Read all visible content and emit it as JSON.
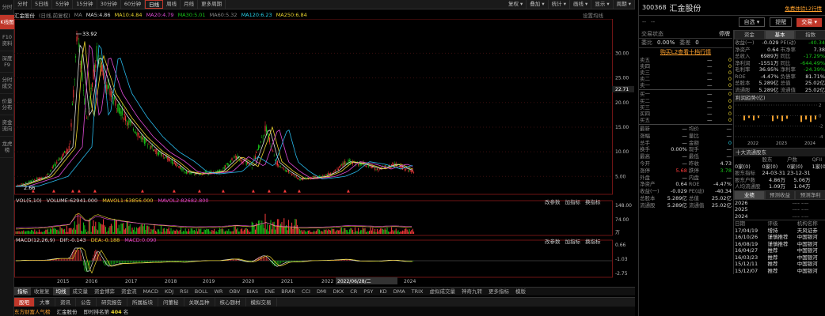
{
  "sidebar": {
    "items": [
      "分时",
      "K线图",
      "F10资料",
      "深度F9",
      "分时成交",
      "价量分布",
      "资金流向",
      "龙虎榜"
    ],
    "active": 1
  },
  "toolbar": {
    "left": [
      "分时",
      "5日线",
      "5分钟",
      "15分钟",
      "30分钟",
      "60分钟",
      "日线",
      "周线",
      "月线",
      "更多周期"
    ],
    "active": "日线",
    "right": [
      "复权",
      "叠加",
      "统计",
      "画线",
      "显示",
      "周期"
    ]
  },
  "indicators_line": {
    "name": "汇金股份",
    "mode": "(日线,前复权)",
    "ma_label": "MA",
    "ma5": "MA5:4.86",
    "ma10": "MA10:4.84",
    "ma20": "MA20:4.79",
    "ma30": "MA30:5.01",
    "ma60": "MA60:5.32",
    "ma120": "MA120:6.23",
    "ma250": "MA250:6.84",
    "settings": "设置均线"
  },
  "kline": {
    "high_marker": "33.92",
    "low_marker": "2.66",
    "y_ticks": [
      "30.00",
      "25.00",
      "20.00",
      "15.00",
      "10.00",
      "5.00"
    ],
    "current_price": "22.71"
  },
  "vol_pane": {
    "label": "VOL(5,10)",
    "volume": "VOLUME:62941.000",
    "mavol1": "MAVOL1:63856.000",
    "mavol2": "MAVOL2:82682.800",
    "actions": [
      "改参数",
      "加指标",
      "换指标"
    ],
    "y_ticks": [
      "148.00",
      "74.00"
    ],
    "unit": "万"
  },
  "macd_pane": {
    "label": "MACD(12,26,9)",
    "dif": "DIF:-0.143",
    "dea": "DEA:-0.188",
    "macd": "MACD:0.090",
    "actions": [
      "改参数",
      "加指标",
      "换指标"
    ],
    "y_ticks": [
      "0.66",
      "-1.03",
      "-2.75"
    ]
  },
  "x_axis": {
    "years": [
      "2015",
      "2016",
      "2017",
      "2018",
      "2019",
      "2020",
      "2021",
      "2022",
      "2023",
      "2024"
    ],
    "cursor_date": "2022/06/28/二"
  },
  "indicator_tabs": [
    "指标",
    "收复复",
    "均线",
    "成交量",
    "资金博弈",
    "资金流",
    "MACD",
    "KDJ",
    "RSI",
    "BOLL",
    "WR",
    "OBV",
    "BIAS",
    "ENE",
    "BRAR",
    "CCI",
    "DMI",
    "DKX",
    "CR",
    "PSY",
    "KD",
    "DMA",
    "TRIX",
    "虚拟成交量",
    "神奇九转",
    "更多指标",
    "模版"
  ],
  "bottom_tabs": [
    "股吧",
    "大事",
    "资讯",
    "公告",
    "研究报告",
    "所属板块",
    "问董秘",
    "关联品种",
    "核心题材",
    "模拟交易"
  ],
  "bottom_status": {
    "brand": "东方财富人气榜",
    "stock": "汇金股份",
    "rank_label": "即时排名第",
    "rank": "404",
    "suffix": "名"
  },
  "right": {
    "code": "300368",
    "name": "汇金股份",
    "dash1": "--",
    "dash2": "--",
    "link": "免费体验L2行情",
    "buttons": [
      "自选",
      "提醒",
      "交易"
    ],
    "state_label": "交易状态",
    "state": "停牌",
    "ratio": {
      "label1": "委比",
      "v1": "0.00%",
      "label2": "委差",
      "v2": "0"
    },
    "l2_link": "购买L2查看十档行情",
    "asks": [
      [
        "卖五",
        "—",
        "0"
      ],
      [
        "卖四",
        "—",
        "0"
      ],
      [
        "卖三",
        "—",
        "0"
      ],
      [
        "卖二",
        "—",
        "0"
      ],
      [
        "卖一",
        "—",
        "0"
      ]
    ],
    "bids": [
      [
        "买一",
        "—",
        "0"
      ],
      [
        "买二",
        "—",
        "0"
      ],
      [
        "买三",
        "—",
        "0"
      ],
      [
        "买四",
        "—",
        "0"
      ],
      [
        "买五",
        "—",
        "0"
      ]
    ],
    "stats": [
      [
        "最新",
        "—",
        "均价",
        "—"
      ],
      [
        "涨幅",
        "—",
        "量比",
        "—"
      ],
      [
        "总手",
        "—",
        "金额",
        "0"
      ],
      [
        "换手",
        "0.00%",
        "现手",
        "—"
      ],
      [
        "最高",
        "—",
        "最低",
        "—"
      ],
      [
        "今开",
        "—",
        "昨收",
        "4.73"
      ],
      [
        "涨停",
        "5.68",
        "跌停",
        "3.78"
      ],
      [
        "外盘",
        "—",
        "内盘",
        "—"
      ],
      [
        "净资产",
        "0.64",
        "ROE",
        "-4.47%"
      ],
      [
        "收益(一)",
        "-0.029",
        "PE(动)",
        "-40.34"
      ],
      [
        "总股本",
        "5.289亿",
        "总值",
        "25.02亿"
      ],
      [
        "流通股",
        "5.289亿",
        "流通值",
        "25.02亿"
      ]
    ],
    "fund_tabs": [
      "资金",
      "基本",
      "指数"
    ],
    "fund": [
      [
        "收益(一)",
        "-0.029",
        "PE(动)",
        "-40.34"
      ],
      [
        "净资产",
        "0.64",
        "市净率",
        "7.38"
      ],
      [
        "总收入",
        "6989万",
        "同比",
        "-17.29%"
      ],
      [
        "净利润",
        "-1551万",
        "同比",
        "-644.49%"
      ],
      [
        "毛利率",
        "36.95%",
        "净利率",
        "-24.39%"
      ],
      [
        "ROE",
        "-4.47%",
        "负债率",
        "81.71%"
      ],
      [
        "总股本",
        "5.289亿",
        "总值",
        "25.02亿"
      ],
      [
        "流通股",
        "5.289亿",
        "流通值",
        "25.02亿"
      ]
    ],
    "profit_title": "利润趋势(亿)",
    "profit_years": [
      "2022",
      "2023",
      "2024"
    ],
    "profit_ticks": [
      "2",
      "0",
      "-2",
      "-4"
    ],
    "holders_title": "十大流通股东",
    "holders_head": [
      "",
      "股东",
      "户数",
      "QFII",
      "股本"
    ],
    "holders_row": [
      "0家(0)",
      "0家(0)",
      "0家(0)",
      "1家(0)"
    ],
    "holders_dates": [
      "股东指标",
      "24-03-31",
      "23-12-31"
    ],
    "holders_rows": [
      [
        "股东户数",
        "4.86万",
        "5.06万"
      ],
      [
        "人均流通股",
        "1.09万",
        "1.04万"
      ]
    ],
    "fc_tabs": [
      "业绩",
      "预测收益",
      "预测净利"
    ],
    "fc_rows": [
      [
        "2026",
        "----",
        "----"
      ],
      [
        "2025",
        "----",
        "----"
      ],
      [
        "2024",
        "----",
        "----"
      ]
    ],
    "rating_head": [
      "日期",
      "评级",
      "机构名称"
    ],
    "ratings": [
      [
        "17/04/19",
        "增持",
        "天风证券"
      ],
      [
        "16/10/26",
        "谨慎推荐",
        "中国银河"
      ],
      [
        "16/08/19",
        "谨慎推荐",
        "中国银河"
      ],
      [
        "16/04/27",
        "推荐",
        "中国银河"
      ],
      [
        "16/03/23",
        "推荐",
        "中国银河"
      ],
      [
        "15/12/11",
        "推荐",
        "中国银河"
      ],
      [
        "15/12/07",
        "推荐",
        "中国银河"
      ]
    ]
  },
  "colors": {
    "up": "#ff3b3b",
    "down": "#18c418",
    "ma_white": "#dddddd",
    "ma_yellow": "#e8d32e",
    "ma_magenta": "#e04bd6",
    "ma_green": "#18c418",
    "ma_blue": "#27b7e8",
    "accent": "#c0372a"
  }
}
